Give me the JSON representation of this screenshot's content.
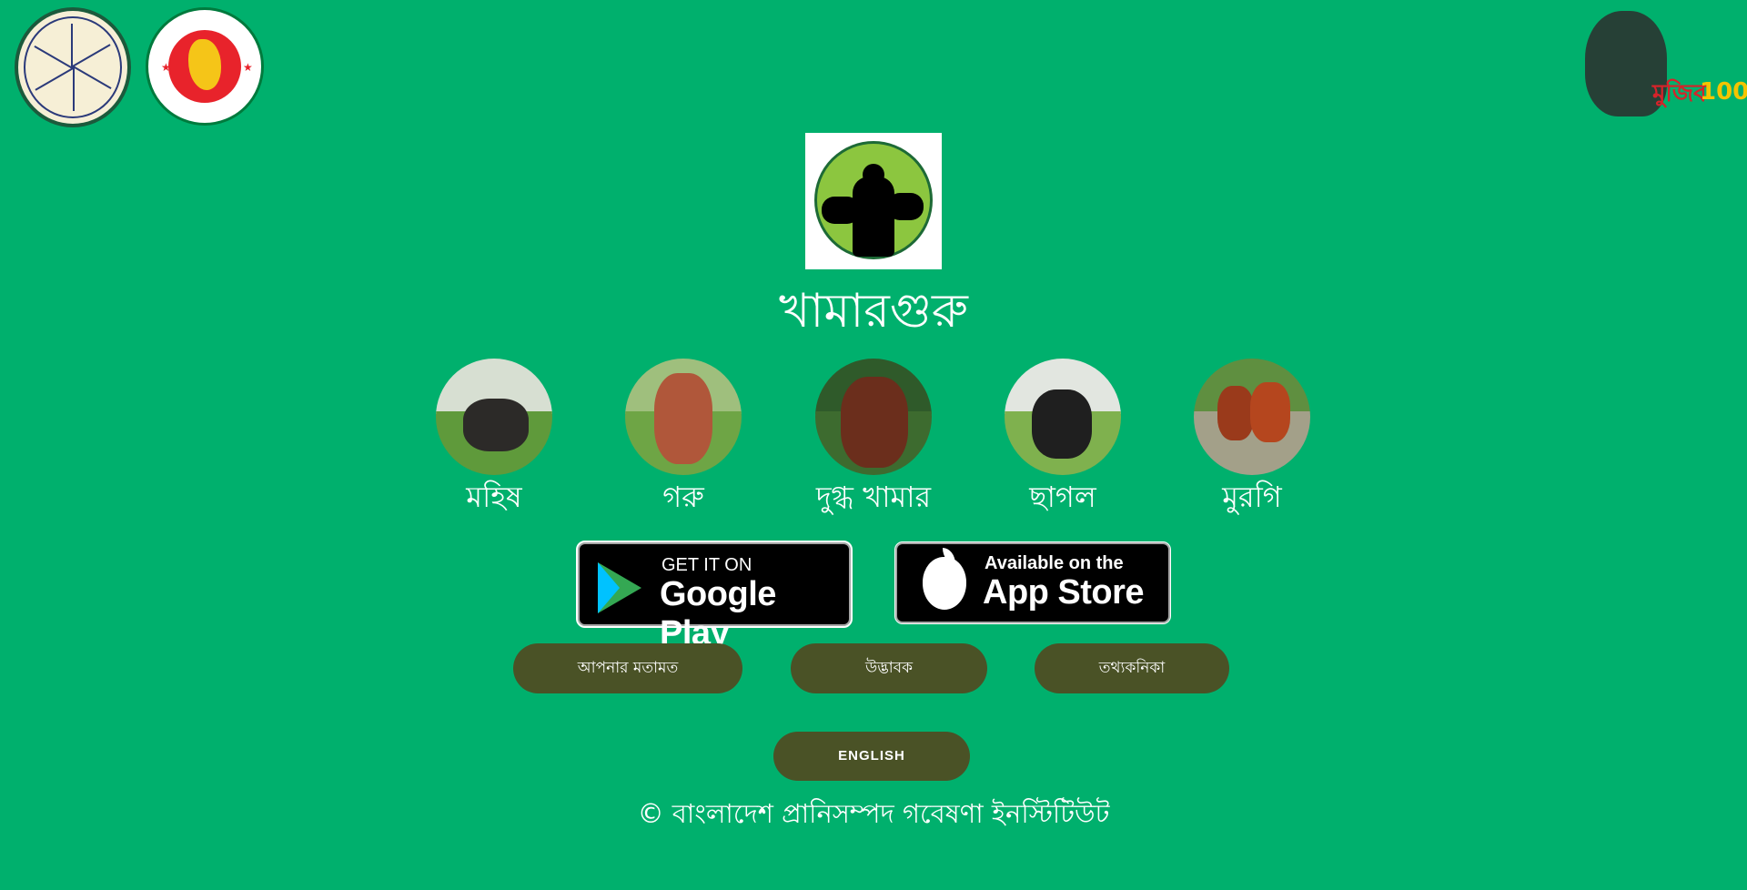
{
  "header": {
    "logo_left_1": "Bangladesh Livestock Research Institute seal",
    "logo_left_2": "Government of Bangladesh seal",
    "logo_right": "Mujib 100 logo",
    "mujib_text_bn": "মুজিব",
    "mujib_text_en": "100"
  },
  "app": {
    "title": "খামারগুরু"
  },
  "animals": [
    {
      "label": "মহিষ",
      "icon": "buffalo-photo"
    },
    {
      "label": "গরু",
      "icon": "cow-photo"
    },
    {
      "label": "দুগ্ধ খামার",
      "icon": "dairy-cow-photo"
    },
    {
      "label": "ছাগল",
      "icon": "goat-photo"
    },
    {
      "label": "মুরগি",
      "icon": "chicken-photo"
    }
  ],
  "stores": {
    "google": {
      "small": "GET IT ON",
      "big": "Google Play"
    },
    "apple": {
      "small": "Available on the",
      "big": "App Store"
    }
  },
  "buttons": {
    "feedback": "আপনার মতামত",
    "innovator": "উদ্ভাবক",
    "info": "তথ্যকনিকা",
    "language": "ENGLISH"
  },
  "footer": {
    "copyright": "© বাংলাদেশ প্রানিসম্পদ গবেষণা ইনস্টিটিউট"
  },
  "colors": {
    "background": "#00b06d",
    "button": "#4a5226",
    "text": "#ffffff"
  }
}
